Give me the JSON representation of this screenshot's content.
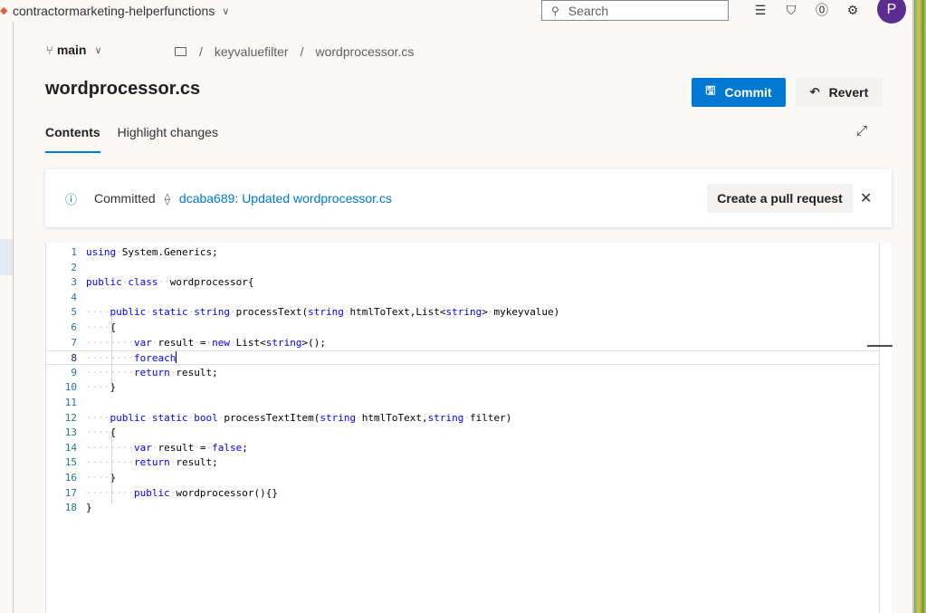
{
  "header": {
    "project_name": "contractormarketing-helperfunctions",
    "search_placeholder": "Search",
    "avatar_initial": "P"
  },
  "repo": {
    "branch": "main",
    "breadcrumb": [
      "keyvaluefilter",
      "wordprocessor.cs"
    ]
  },
  "file": {
    "title": "wordprocessor.cs",
    "commit_label": "Commit",
    "revert_label": "Revert"
  },
  "tabs": [
    {
      "label": "Contents",
      "active": true
    },
    {
      "label": "Highlight changes",
      "active": false
    }
  ],
  "banner": {
    "status": "Committed",
    "commit_link": "dcaba689: Updated wordprocessor.cs",
    "pr_button": "Create a pull request"
  },
  "editor": {
    "current_line": 8,
    "lines": [
      {
        "n": "1",
        "html": "<span class='kw'>using</span><span class='ws'>·</span>System.Generics;"
      },
      {
        "n": "2",
        "html": ""
      },
      {
        "n": "3",
        "html": "<span class='kw'>public</span><span class='ws'>·</span><span class='kw'>class</span><span class='ws'>··</span>wordprocessor{"
      },
      {
        "n": "4",
        "html": ""
      },
      {
        "n": "5",
        "html": "<span class='ws'>····</span><span class='kw'>public</span><span class='ws'>·</span><span class='kw'>static</span><span class='ws'>·</span><span class='kw'>string</span><span class='ws'>·</span>processText(<span class='kw'>string</span><span class='ws'>·</span>htmlToText,List&lt;<span class='kw'>string</span>&gt;<span class='ws'>·</span>mykeyvalue)"
      },
      {
        "n": "6",
        "html": "<span class='ws'>····</span>{"
      },
      {
        "n": "7",
        "html": "<span class='ws'>········</span><span class='kw'>var</span><span class='ws'>·</span>result<span class='ws'>·</span>=<span class='ws'>·</span><span class='kw'>new</span><span class='ws'>·</span>List&lt;<span class='kw'>string</span>&gt;();"
      },
      {
        "n": "8",
        "html": "<span class='ws'>········</span><span class='kw'>foreach</span><span class='cursor'></span>"
      },
      {
        "n": "9",
        "html": "<span class='ws'>········</span><span class='kw'>return</span><span class='ws'>·</span>result;"
      },
      {
        "n": "10",
        "html": "<span class='ws'>····</span>}"
      },
      {
        "n": "11",
        "html": ""
      },
      {
        "n": "12",
        "html": "<span class='ws'>····</span><span class='kw'>public</span><span class='ws'>·</span><span class='kw'>static</span><span class='ws'>·</span><span class='kw'>bool</span><span class='ws'>·</span>processTextItem(<span class='kw'>string</span><span class='ws'>·</span>htmlToText,<span class='kw'>string</span><span class='ws'>·</span>filter)"
      },
      {
        "n": "13",
        "html": "<span class='ws'>····</span>{"
      },
      {
        "n": "14",
        "html": "<span class='ws'>········</span><span class='kw'>var</span><span class='ws'>·</span>result<span class='ws'>·</span>=<span class='ws'>·</span><span class='kw'>false</span>;"
      },
      {
        "n": "15",
        "html": "<span class='ws'>········</span><span class='kw'>return</span><span class='ws'>·</span>result;"
      },
      {
        "n": "16",
        "html": "<span class='ws'>····</span>}"
      },
      {
        "n": "17",
        "html": "<span class='ws'>········</span><span class='kw'>public</span><span class='ws'>·</span>wordprocessor(){}"
      },
      {
        "n": "18",
        "html": "}"
      }
    ]
  },
  "colors": {
    "accent": "#0078d4",
    "avatar": "#5c2d91",
    "keyword": "#0000ff"
  }
}
